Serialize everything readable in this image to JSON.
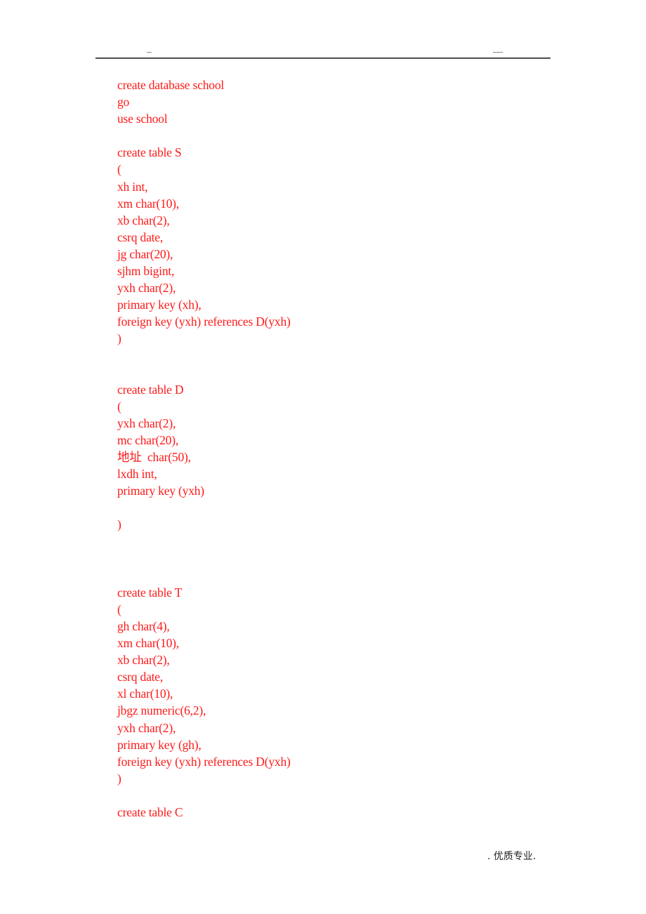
{
  "header": {
    "left_mark": "—",
    "right_mark": "——"
  },
  "code_lines": [
    "create database school",
    "go",
    "use school",
    "",
    "create table S",
    "(",
    "xh int,",
    "xm char(10),",
    "xb char(2),",
    "csrq date,",
    "jg char(20),",
    "sjhm bigint,",
    "yxh char(2),",
    "primary key (xh),",
    "foreign key (yxh) references D(yxh)",
    ")",
    "",
    "",
    "create table D",
    "(",
    "yxh char(2),",
    "mc char(20),",
    "地址  char(50),",
    "lxdh int,",
    "primary key (yxh)",
    "",
    ")",
    "",
    "",
    "",
    "create table T",
    "(",
    "gh char(4),",
    "xm char(10),",
    "xb char(2),",
    "csrq date,",
    "xl char(10),",
    "jbgz numeric(6,2),",
    "yxh char(2),",
    "primary key (gh),",
    "foreign key (yxh) references D(yxh)",
    ")",
    "",
    "create table C"
  ],
  "footer": {
    "text": ". 优质专业."
  },
  "colors": {
    "code_text": "#ff1a1a",
    "footer_text": "#222222"
  }
}
